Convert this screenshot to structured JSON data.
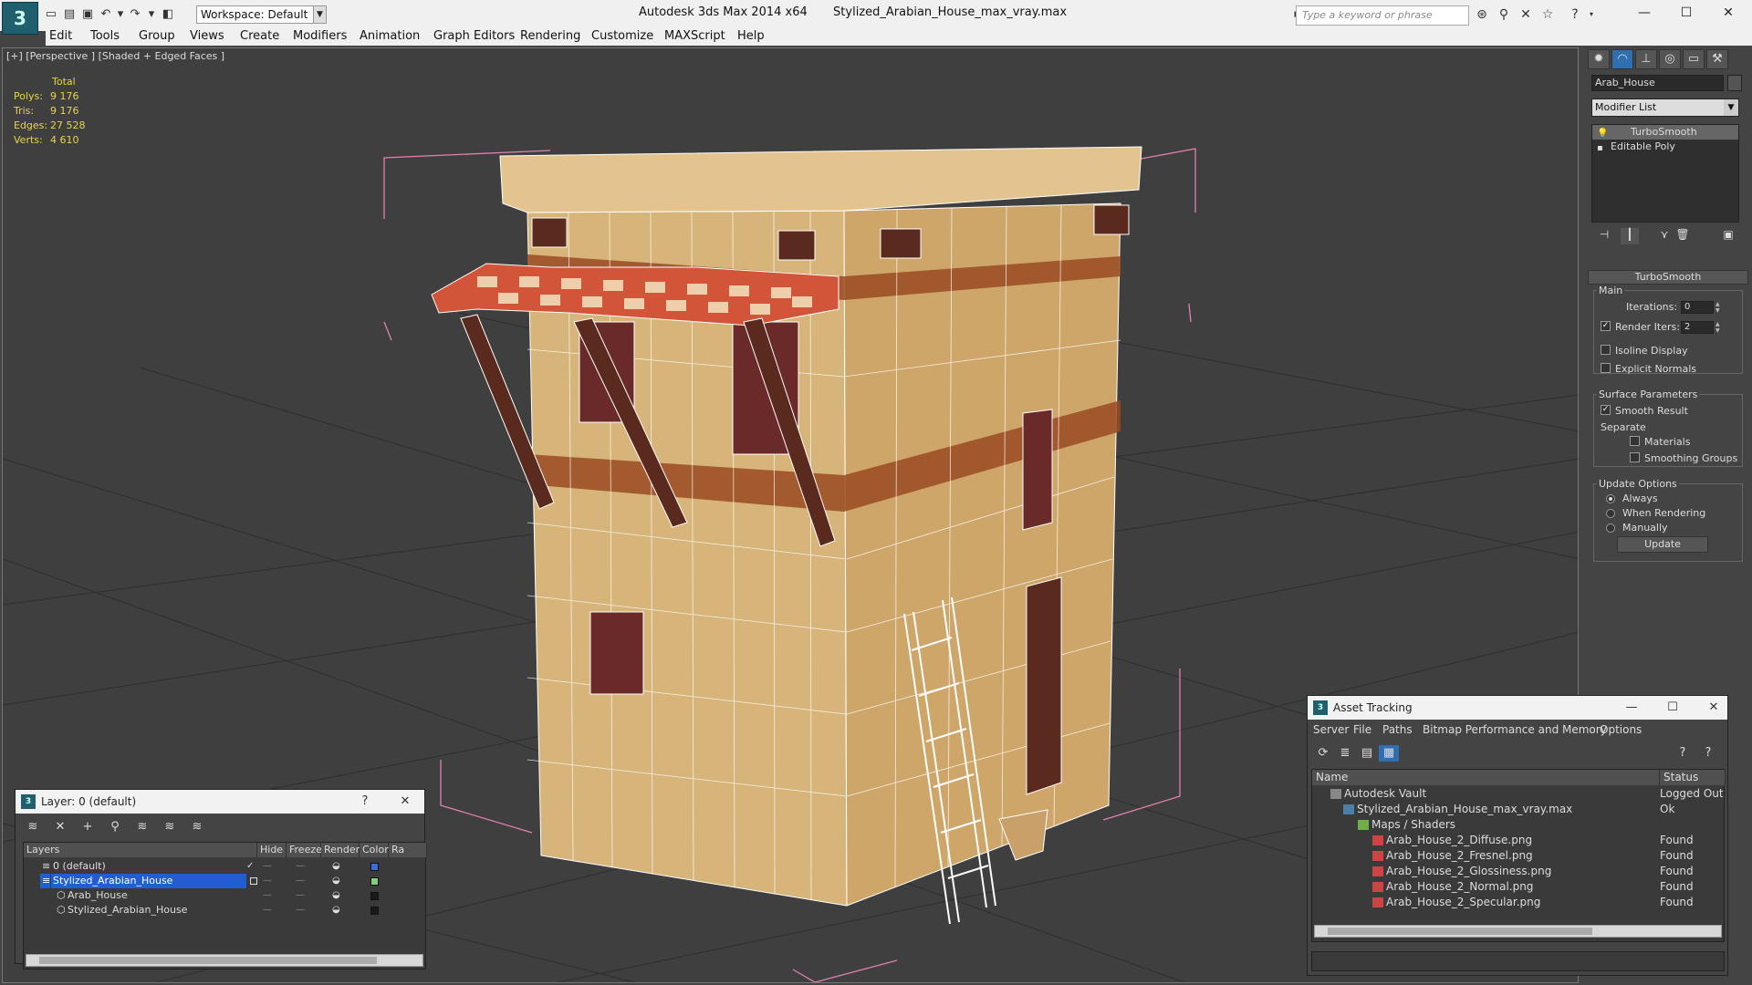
{
  "titlebar": {
    "workspace_label": "Workspace: Default",
    "app_name": "Autodesk 3ds Max  2014 x64",
    "file_name": "Stylized_Arabian_House_max_vray.max",
    "search_placeholder": "Type a keyword or phrase"
  },
  "menu": [
    "Edit",
    "Tools",
    "Group",
    "Views",
    "Create",
    "Modifiers",
    "Animation",
    "Graph Editors",
    "Rendering",
    "Customize",
    "MAXScript",
    "Help"
  ],
  "viewport": {
    "label": "[+] [Perspective ] [Shaded + Edged Faces ]",
    "stats": {
      "header": "Total",
      "rows": [
        {
          "key": "Polys:",
          "value": "9 176"
        },
        {
          "key": "Tris:",
          "value": "9 176"
        },
        {
          "key": "Edges:",
          "value": "27 528"
        },
        {
          "key": "Verts:",
          "value": "4 610"
        }
      ]
    }
  },
  "command_panel": {
    "object_name": "Arab_House",
    "modifier_list": "Modifier List",
    "stack": [
      "TurboSmooth",
      "Editable Poly"
    ],
    "rollout_title": "TurboSmooth",
    "main_label": "Main",
    "iterations_label": "Iterations:",
    "iterations_value": "0",
    "render_iters_label": "Render Iters:",
    "render_iters_value": "2",
    "isoline_label": "Isoline Display",
    "explicit_normals_label": "Explicit Normals",
    "surface_params_label": "Surface Parameters",
    "smooth_result_label": "Smooth Result",
    "separate_label": "Separate",
    "materials_label": "Materials",
    "smoothing_groups_label": "Smoothing Groups",
    "update_options_label": "Update Options",
    "always_label": "Always",
    "when_rendering_label": "When Rendering",
    "manually_label": "Manually",
    "update_button": "Update"
  },
  "layer_window": {
    "title": "Layer: 0 (default)",
    "columns": [
      "Layers",
      "Hide",
      "Freeze",
      "Render",
      "Color",
      "Ra"
    ],
    "rows": [
      {
        "name": "0 (default)",
        "indent": 1,
        "color": "#3a6fd8"
      },
      {
        "name": "Stylized_Arabian_House",
        "indent": 1,
        "color": "#7fcf7f",
        "selected": true
      },
      {
        "name": "Arab_House",
        "indent": 2,
        "color": "#1a1a1a"
      },
      {
        "name": "Stylized_Arabian_House",
        "indent": 2,
        "color": "#1a1a1a"
      }
    ]
  },
  "asset_tracking": {
    "title": "Asset Tracking",
    "menu": [
      "Server",
      "File",
      "Paths",
      "Bitmap Performance and Memory",
      "Options"
    ],
    "columns": [
      "Name",
      "Status"
    ],
    "rows": [
      {
        "name": "Autodesk Vault",
        "indent": 1,
        "status": "Logged Out"
      },
      {
        "name": "Stylized_Arabian_House_max_vray.max",
        "indent": 2,
        "status": "Ok"
      },
      {
        "name": "Maps / Shaders",
        "indent": 3,
        "status": ""
      },
      {
        "name": "Arab_House_2_Diffuse.png",
        "indent": 4,
        "status": "Found"
      },
      {
        "name": "Arab_House_2_Fresnel.png",
        "indent": 4,
        "status": "Found"
      },
      {
        "name": "Arab_House_2_Glossiness.png",
        "indent": 4,
        "status": "Found"
      },
      {
        "name": "Arab_House_2_Normal.png",
        "indent": 4,
        "status": "Found"
      },
      {
        "name": "Arab_House_2_Specular.png",
        "indent": 4,
        "status": "Found"
      }
    ]
  },
  "colors": {
    "stats_yellow": "#e7d548",
    "selection_blue": "#1f5fd1",
    "wall_sand": "#d6b47a",
    "trim_brown": "#9a4a22",
    "awning_red": "#d2553a",
    "bbox_pink": "#e080b0"
  }
}
